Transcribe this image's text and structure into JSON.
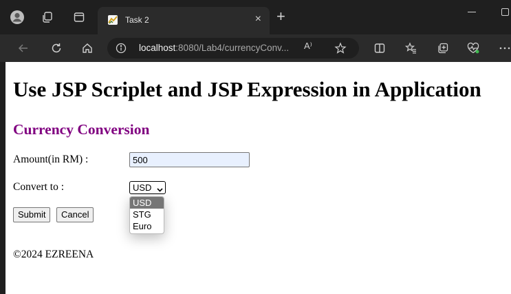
{
  "browser": {
    "tab": {
      "title": "Task 2",
      "close_glyph": "×"
    },
    "new_tab_glyph": "+",
    "address": {
      "host": "localhost",
      "rest": ":8080/Lab4/currencyConv...",
      "read_aloud": "A⁾"
    },
    "icons": [
      "profile-icon",
      "workspaces-icon",
      "tab-actions-icon",
      "back-icon",
      "refresh-icon",
      "home-icon",
      "site-info-icon",
      "read-aloud-icon",
      "favorite-icon",
      "split-screen-icon",
      "favorites-icon",
      "collections-icon",
      "performance-icon",
      "more-icon"
    ],
    "colors": {
      "frame": "#1f1f1f",
      "toolbar": "#2b2b2b"
    }
  },
  "page": {
    "heading": "Use JSP Scriplet and JSP Expression in Application",
    "subheading": "Currency Conversion",
    "amount_label": "Amount(in RM) :",
    "amount_value": "500",
    "convert_label": "Convert to :",
    "currency_selected": "USD",
    "currency_options": [
      "USD",
      "STG",
      "Euro"
    ],
    "submit_label": "Submit",
    "cancel_label": "Cancel",
    "footer": "©2024 EZREENA",
    "colors": {
      "subheading": "#800080",
      "input_autofill": "#e8f0fe",
      "option_highlight": "#767676"
    }
  }
}
